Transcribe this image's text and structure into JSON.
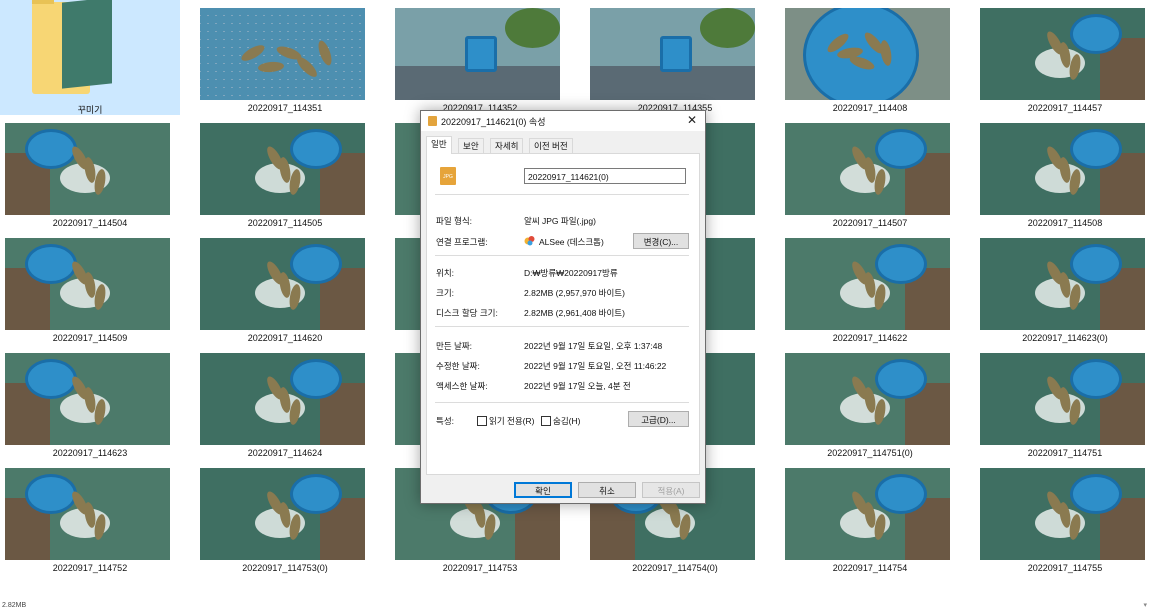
{
  "explorer": {
    "tiles": [
      {
        "caption": "꾸미기",
        "type": "folder"
      },
      {
        "caption": "20220917_114351"
      },
      {
        "caption": "20220917_114352"
      },
      {
        "caption": "20220917_114355"
      },
      {
        "caption": "20220917_114408"
      },
      {
        "caption": "20220917_114457"
      },
      {
        "caption": "20220917_114504"
      },
      {
        "caption": "20220917_114505"
      },
      {
        "caption": ""
      },
      {
        "caption": "0)"
      },
      {
        "caption": "20220917_114507"
      },
      {
        "caption": "20220917_114508"
      },
      {
        "caption": "20220917_114509"
      },
      {
        "caption": "20220917_114620"
      },
      {
        "caption": ""
      },
      {
        "caption": ""
      },
      {
        "caption": "20220917_114622"
      },
      {
        "caption": "20220917_114623(0)"
      },
      {
        "caption": "20220917_114623"
      },
      {
        "caption": "20220917_114624"
      },
      {
        "caption": ""
      },
      {
        "caption": ")"
      },
      {
        "caption": "20220917_114751(0)"
      },
      {
        "caption": "20220917_114751"
      },
      {
        "caption": "20220917_114752"
      },
      {
        "caption": "20220917_114753(0)"
      },
      {
        "caption": "20220917_114753"
      },
      {
        "caption": "20220917_114754(0)"
      },
      {
        "caption": "20220917_114754"
      },
      {
        "caption": "20220917_114755"
      }
    ],
    "status_text": "2.82MB",
    "status_scroll_icon": "scroll-down-icon"
  },
  "dialog": {
    "title": "20220917_114621(0) 속성",
    "close_glyph": "✕",
    "tabs": [
      "일반",
      "보안",
      "자세히",
      "이전 버전"
    ],
    "active_tab": "일반",
    "file_icon_text": "JPG",
    "file_name": "20220917_114621(0)",
    "file_type_label": "파일 형식:",
    "file_type_value": "알씨 JPG 파일(.jpg)",
    "open_with_label": "연결 프로그램:",
    "open_with_value": "ALSee (데스크톱)",
    "change_button": "변경(C)...",
    "location_label": "위치:",
    "location_value": "D:₩방류₩20220917방류",
    "size_label": "크기:",
    "size_value": "2.82MB (2,957,970 바이트)",
    "disk_size_label": "디스크 할당 크기:",
    "disk_size_value": "2.82MB (2,961,408 바이트)",
    "created_label": "만든 날짜:",
    "created_value": "2022년 9월 17일 토요일, 오후 1:37:48",
    "modified_label": "수정한 날짜:",
    "modified_value": "2022년 9월 17일 토요일, 오전 11:46:22",
    "accessed_label": "액세스한 날짜:",
    "accessed_value": "2022년 9월 17일 오늘, 4분 전",
    "attributes_label": "특성:",
    "readonly_label": "읽기 전용(R)",
    "hidden_label": "숨김(H)",
    "advanced_button": "고급(D)...",
    "ok_button": "확인",
    "cancel_button": "취소",
    "apply_button": "적용(A)"
  }
}
